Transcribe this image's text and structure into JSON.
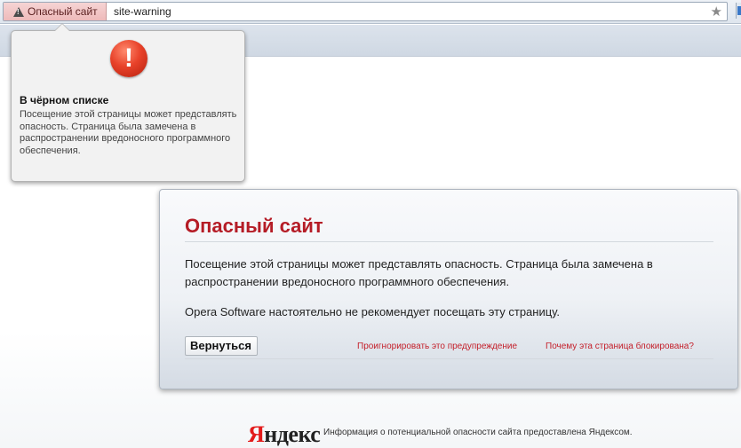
{
  "browser": {
    "security_badge": "Опасный сайт",
    "address_value": "site-warning"
  },
  "popup": {
    "title": "В чёрном списке",
    "text": "Посещение этой страницы может представлять опасность. Страница была замечена в распространении вредоносного программного обеспечения."
  },
  "dialog": {
    "title": "Опасный сайт",
    "paragraph1": "Посещение этой страницы может представлять опасность. Страница была замечена в распространении вредоносного программного обеспечения.",
    "paragraph2": "Opera Software настоятельно не рекомендует посещать эту страницу.",
    "back_label": "Вернуться",
    "ignore_link": "Проигнорировать это предупреждение",
    "why_link": "Почему эта страница блокирована?"
  },
  "footer": {
    "logo_first": "Я",
    "logo_rest": "ндекс",
    "text": "Информация о потенциальной опасности сайта предоставлена Яндексом."
  },
  "colors": {
    "accent_red": "#b51c26",
    "link_red": "#c4202b",
    "badge_bg": "#f6d4d4"
  }
}
